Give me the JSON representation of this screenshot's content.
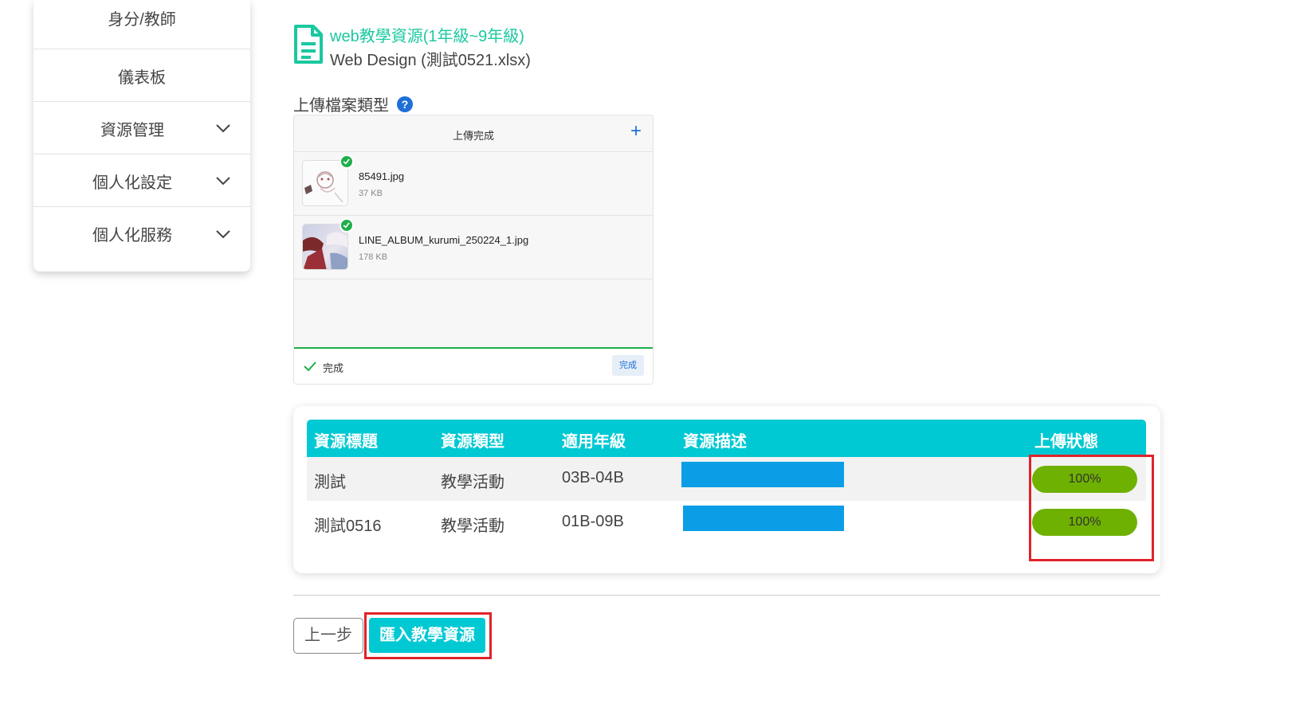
{
  "sidebar": {
    "items": [
      {
        "label": "身分/教師",
        "chevron": false
      },
      {
        "label": "儀表板",
        "chevron": false
      },
      {
        "label": "資源管理",
        "chevron": true
      },
      {
        "label": "個人化設定",
        "chevron": true
      },
      {
        "label": "個人化服務",
        "chevron": true
      }
    ]
  },
  "file": {
    "title": "web教學資源(1年級~9年級)",
    "subtitle": "Web Design (測試0521.xlsx)"
  },
  "upload_type": {
    "label": "上傳檔案類型",
    "help_icon": "?"
  },
  "uploader": {
    "header": "上傳完成",
    "add_icon": "+",
    "files": [
      {
        "name": "85491.jpg",
        "size": "37 KB"
      },
      {
        "name": "LINE_ALBUM_kurumi_250224_1.jpg",
        "size": "178 KB"
      }
    ],
    "footer_status": "完成",
    "footer_button": "完成"
  },
  "table": {
    "headers": [
      "資源標題",
      "資源類型",
      "適用年級",
      "資源描述",
      "上傳狀態"
    ],
    "rows": [
      {
        "title": "測試",
        "type": "教學活動",
        "grade": "03B-04B",
        "status": "100%"
      },
      {
        "title": "測試0516",
        "type": "教學活動",
        "grade": "01B-09B",
        "status": "100%"
      }
    ]
  },
  "buttons": {
    "prev": "上一步",
    "import": "匯入教學資源"
  },
  "colors": {
    "accent": "#00c9d3",
    "title_green": "#1bc8a0",
    "success": "#6eb100",
    "highlight": "#e0232a",
    "desc_bar": "#0b9ee6"
  }
}
